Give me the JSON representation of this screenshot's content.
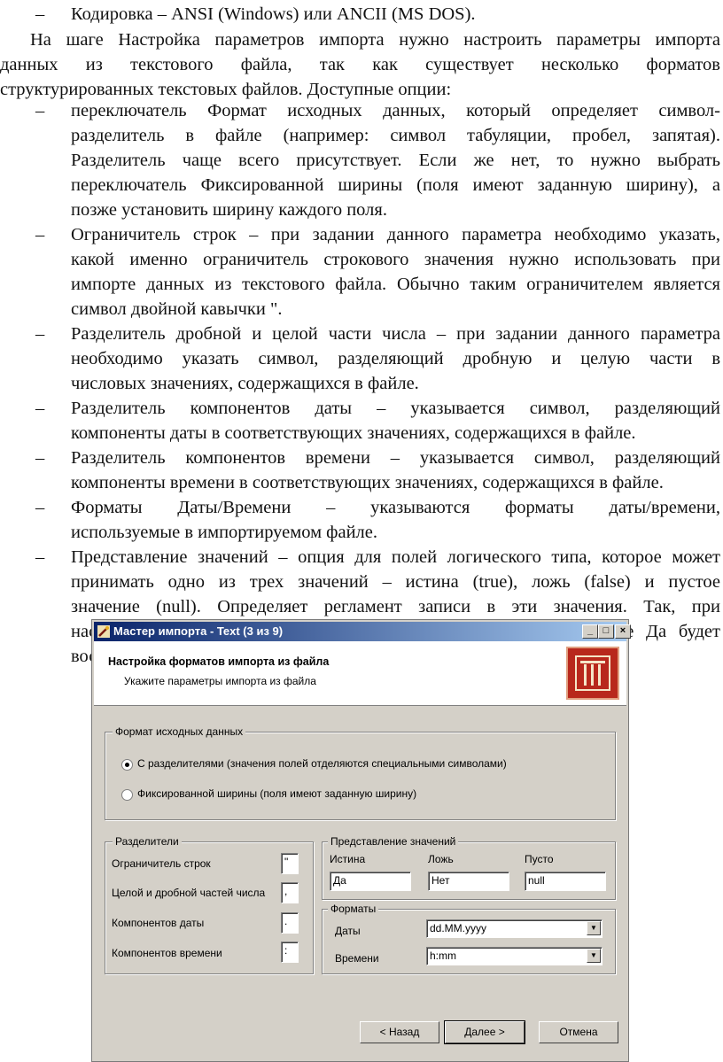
{
  "paragraphs": {
    "l1": "Кодировка – ANSI (Windows) или ANCII (MS DOS).",
    "l2": "На шаге Настройка параметров импорта нужно настроить параметры импорта",
    "l3": "данных из текстового файла, так как существует несколько форматов",
    "l4": "структурированных текстовых файлов. Доступные опции:"
  },
  "bullets": [
    {
      "lines": [
        "переключатель Формат исходных данных, который определяет символ-",
        "разделитель в файле (например: символ табуляции, пробел, запятая).",
        "Разделитель чаще всего присутствует. Если же нет, то нужно выбрать",
        "переключатель Фиксированной ширины (поля имеют заданную ширину), а",
        "позже установить ширину каждого поля."
      ]
    },
    {
      "lines": [
        "Ограничитель строк – при задании данного параметра необходимо указать,",
        "какой именно ограничитель строкового значения нужно использовать при",
        "импорте данных из текстового файла. Обычно таким ограничителем является",
        "символ двойной кавычки \"."
      ]
    },
    {
      "lines": [
        "Разделитель дробной и целой части числа – при задании данного параметра",
        "необходимо указать символ, разделяющий дробную и целую части в",
        "числовых значениях, содержащихся в файле."
      ]
    },
    {
      "lines": [
        "Разделитель компонентов даты – указывается символ, разделяющий",
        "компоненты даты в соответствующих значениях, содержащихся в файле."
      ]
    },
    {
      "lines": [
        "Разделитель компонентов времени – указывается символ, разделяющий",
        "компоненты времени в соответствующих значениях, содержащихся в файле."
      ]
    },
    {
      "lines": [
        "Форматы Даты/Времени – указываются форматы даты/времени,",
        "используемые в импортируемом файле."
      ]
    },
    {
      "lines": [
        "Представление значений – опция для полей логического типа, которое может",
        "принимать одно из трех значений – истина (true), ложь (false) и пустое",
        "значение (null). Определяет регламент записи в эти значения. Так, при",
        "настройках по умолчанию для любого логического поля значение Да будет",
        "восприниматься как истина, Нет – как ложь."
      ]
    }
  ],
  "bullet_marker": "–",
  "dialog": {
    "title": "Мастер импорта - Text (3 из 9)",
    "header_title": "Настройка форматов импорта из файла",
    "header_subtitle": "Укажите параметры импорта из файла",
    "format_group": {
      "legend": "Формат исходных данных",
      "option_delimited": "С разделителями (значения полей отделяются специальными символами)",
      "option_fixed": "Фиксированной ширины (поля имеют заданную ширину)"
    },
    "separators_group": {
      "legend": "Разделители",
      "string_delim_label": "Ограничитель строк",
      "string_delim_value": "\"",
      "decimal_label": "Целой и дробной частей числа",
      "decimal_value": ",",
      "date_label": "Компонентов даты",
      "date_value": ".",
      "time_label": "Компонентов времени",
      "time_value": ":"
    },
    "values_group": {
      "legend": "Представление значений",
      "true_label": "Истина",
      "false_label": "Ложь",
      "empty_label": "Пусто",
      "true_value": "Да",
      "false_value": "Нет",
      "empty_value": "null"
    },
    "formats_group": {
      "legend": "Форматы",
      "date_label": "Даты",
      "date_value": "dd.MM.yyyy",
      "time_label": "Времени",
      "time_value": "h:mm"
    },
    "buttons": {
      "back": "< Назад",
      "next": "Далее >",
      "cancel": "Отмена"
    },
    "window_buttons": {
      "minimize": "_",
      "maximize": "□",
      "close": "×"
    }
  },
  "colors": {
    "title_start": "#0a246a",
    "title_end": "#a6caf0",
    "logo_red": "#b8281c"
  }
}
